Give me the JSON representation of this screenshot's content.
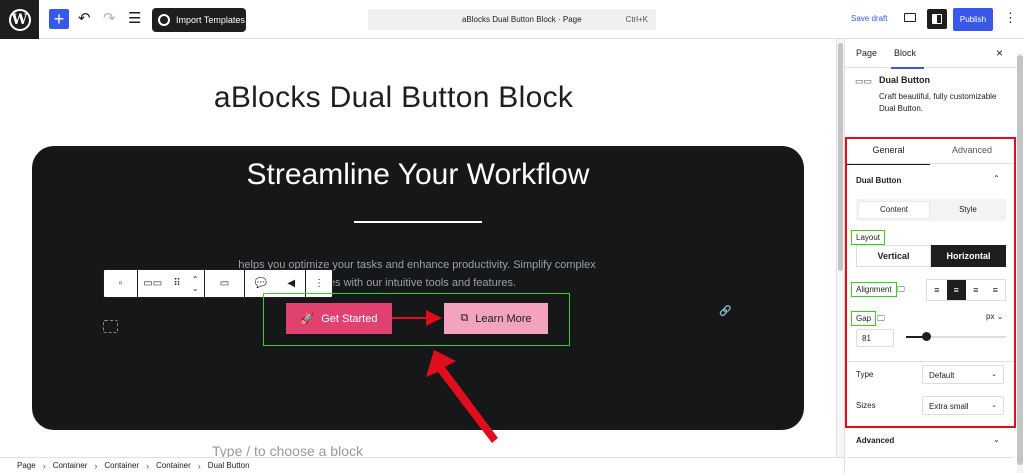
{
  "topbar": {
    "logo": "W",
    "add_icon": "+",
    "undo_icon": "↶",
    "redo_icon": "↷",
    "list_view_icon": "☰",
    "import_label": "Import Templates",
    "command_title": "aBlocks Dual Button Block · Page",
    "command_shortcut": "Ctrl+K",
    "save_draft": "Save draft",
    "publish": "Publish",
    "more_icon": "⋮"
  },
  "editor": {
    "page_title": "aBlocks Dual Button Block",
    "hero_heading": "Streamline Your Workflow",
    "hero_text_line1": "helps you optimize your tasks and enhance productivity. Simplify complex",
    "hero_text_line2": "sses with our intuitive tools and features.",
    "button_primary": "Get Started",
    "button_secondary": "Learn More",
    "type_hint": "Type / to choose a block",
    "accent_primary": "#e0416f",
    "accent_secondary": "#f3a4bc"
  },
  "breadcrumb": [
    "Page",
    "Container",
    "Container",
    "Container",
    "Dual Button"
  ],
  "sidebar": {
    "tab_page": "Page",
    "tab_block": "Block",
    "close_icon": "×",
    "block_name": "Dual Button",
    "block_desc": "Craft beautiful, fully customizable Dual Button.",
    "tab_general": "General",
    "tab_advanced": "Advanced",
    "section_title": "Dual Button",
    "seg_content": "Content",
    "seg_style": "Style",
    "layout_label": "Layout",
    "layout_vertical": "Vertical",
    "layout_horizontal": "Horizontal",
    "alignment_label": "Alignment",
    "gap_label": "Gap",
    "gap_unit": "px",
    "gap_value": "81",
    "type_label": "Type",
    "type_value": "Default",
    "sizes_label": "Sizes",
    "sizes_value": "Extra small",
    "advanced_section": "Advanced"
  }
}
